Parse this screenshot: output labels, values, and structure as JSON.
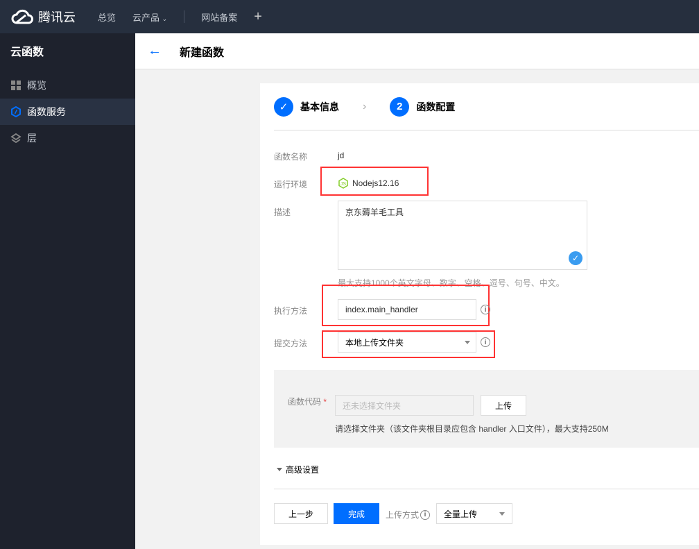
{
  "topbar": {
    "brand": "腾讯云",
    "nav": [
      "总览",
      "云产品",
      "网站备案"
    ],
    "plus": "+"
  },
  "sidebar": {
    "title": "云函数",
    "items": [
      {
        "label": "概览",
        "icon": "grid-icon"
      },
      {
        "label": "函数服务",
        "icon": "function-icon",
        "active": true
      },
      {
        "label": "层",
        "icon": "layers-icon"
      }
    ]
  },
  "header": {
    "title": "新建函数"
  },
  "steps": [
    {
      "label": "基本信息",
      "state": "done"
    },
    {
      "num": "2",
      "label": "函数配置",
      "state": "active"
    }
  ],
  "form": {
    "name_label": "函数名称",
    "name_value": "jd",
    "runtime_label": "运行环境",
    "runtime_value": "Nodejs12.16",
    "desc_label": "描述",
    "desc_value": "京东薅羊毛工具",
    "desc_hint": "最大支持1000个英文字母、数字、空格、逗号、句号、中文。",
    "handler_label": "执行方法",
    "handler_value": "index.main_handler",
    "submit_label": "提交方法",
    "submit_value": "本地上传文件夹",
    "code_label": "函数代码",
    "code_required": "*",
    "code_placeholder": "还未选择文件夹",
    "upload_btn": "上传",
    "code_hint": "请选择文件夹（该文件夹根目录应包含 handler 入口文件），最大支持250M",
    "advanced": "高级设置"
  },
  "footer": {
    "prev": "上一步",
    "finish": "完成",
    "upload_mode_label": "上传方式",
    "upload_mode_value": "全量上传"
  },
  "colors": {
    "accent": "#006eff",
    "highlight": "#ff3333",
    "topbar": "#262f3e",
    "sidebar": "#1e222d"
  }
}
